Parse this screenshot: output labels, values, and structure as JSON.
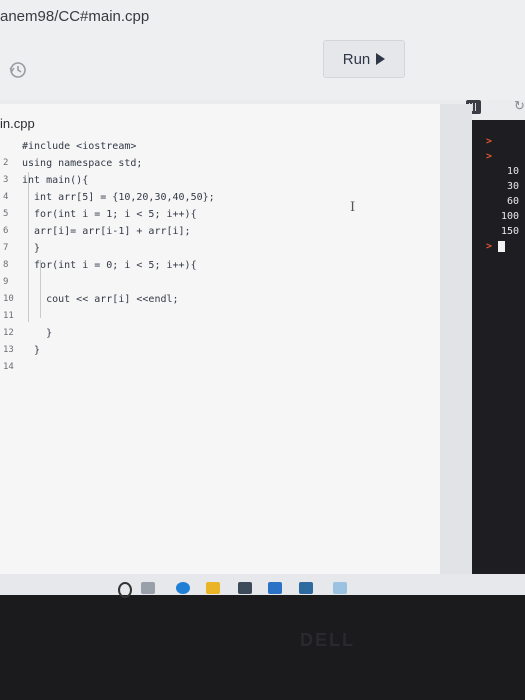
{
  "window": {
    "title": "anem98/CC#main.cpp"
  },
  "toolbar": {
    "run_label": "Run"
  },
  "editor": {
    "file_name": "in.cpp",
    "lines": [
      {
        "number": "",
        "code": "#include <iostream>"
      },
      {
        "number": "2",
        "code": "using namespace std;"
      },
      {
        "number": "3",
        "code": "int main(){"
      },
      {
        "number": "4",
        "code": "  int arr[5] = {10,20,30,40,50};"
      },
      {
        "number": "5",
        "code": "  for(int i = 1; i < 5; i++){"
      },
      {
        "number": "6",
        "code": "  arr[i]= arr[i-1] + arr[i];"
      },
      {
        "number": "7",
        "code": "  }"
      },
      {
        "number": "8",
        "code": "  for(int i = 0; i < 5; i++){"
      },
      {
        "number": "9",
        "code": ""
      },
      {
        "number": "10",
        "code": "    cout << arr[i] <<endl;"
      },
      {
        "number": "11",
        "code": ""
      },
      {
        "number": "12",
        "code": "    }"
      },
      {
        "number": "13",
        "code": "  }"
      },
      {
        "number": "14",
        "code": ""
      }
    ]
  },
  "console": {
    "prompt_symbol": ">",
    "output": [
      "10",
      "30",
      "60",
      "100",
      "150"
    ]
  },
  "colors": {
    "keyword": "#2c64c8",
    "prompt": "#e0552f",
    "console_bg": "#1e1e22"
  }
}
